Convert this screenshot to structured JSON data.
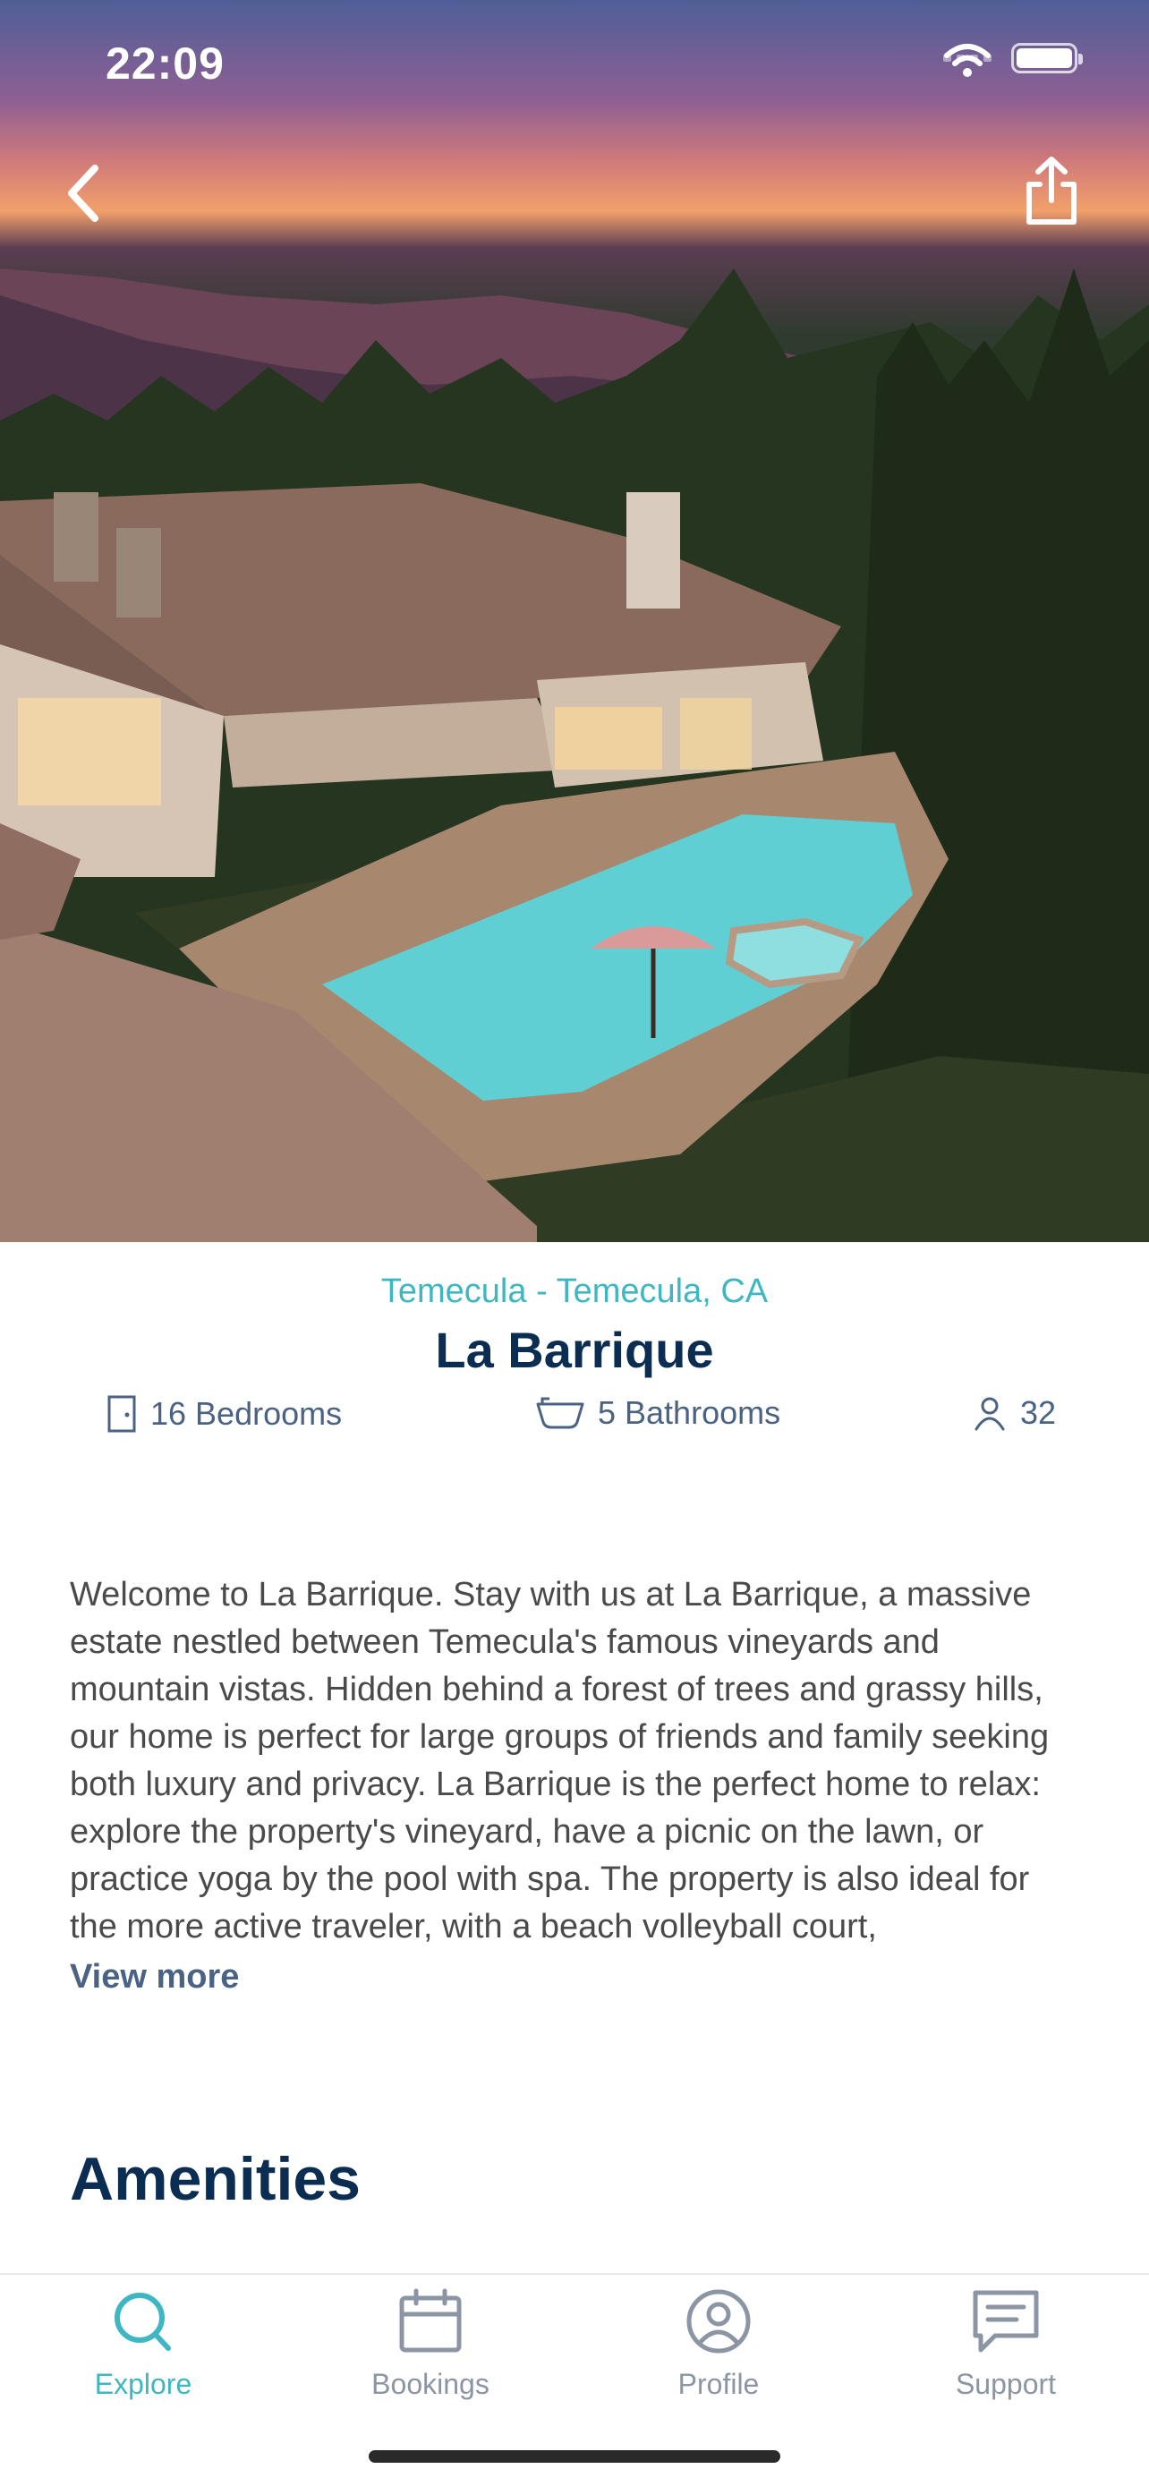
{
  "status_bar": {
    "time": "22:09"
  },
  "hero": {
    "back_icon": "chevron-left-icon",
    "share_icon": "share-icon"
  },
  "property": {
    "location": "Temecula - Temecula, CA",
    "name": "La Barrique",
    "bedrooms": "16 Bedrooms",
    "bathrooms": "5 Bathrooms",
    "guests": "32",
    "description": "Welcome to La Barrique. Stay with us at La Barrique, a massive estate nestled between Temecula's famous vineyards and mountain vistas. Hidden behind a forest of trees and grassy hills, our home is perfect for large groups of friends and family seeking both luxury and privacy. La Barrique is the perfect home to relax: explore the property's vineyard, have a picnic on the lawn, or practice yoga by the pool with spa. The property is also ideal for the more active traveler, with a beach volleyball court,",
    "view_more": "View more"
  },
  "sections": {
    "amenities_title": "Amenities"
  },
  "tabbar": {
    "tabs": [
      {
        "label": "Explore",
        "icon": "search-icon",
        "active": true
      },
      {
        "label": "Bookings",
        "icon": "calendar-icon",
        "active": false
      },
      {
        "label": "Profile",
        "icon": "profile-icon",
        "active": false
      },
      {
        "label": "Support",
        "icon": "chat-icon",
        "active": false
      }
    ]
  },
  "colors": {
    "accent": "#3fb7c2",
    "navy": "#0c2d52",
    "muted": "#4a6283",
    "inactive": "#8c95a4"
  }
}
